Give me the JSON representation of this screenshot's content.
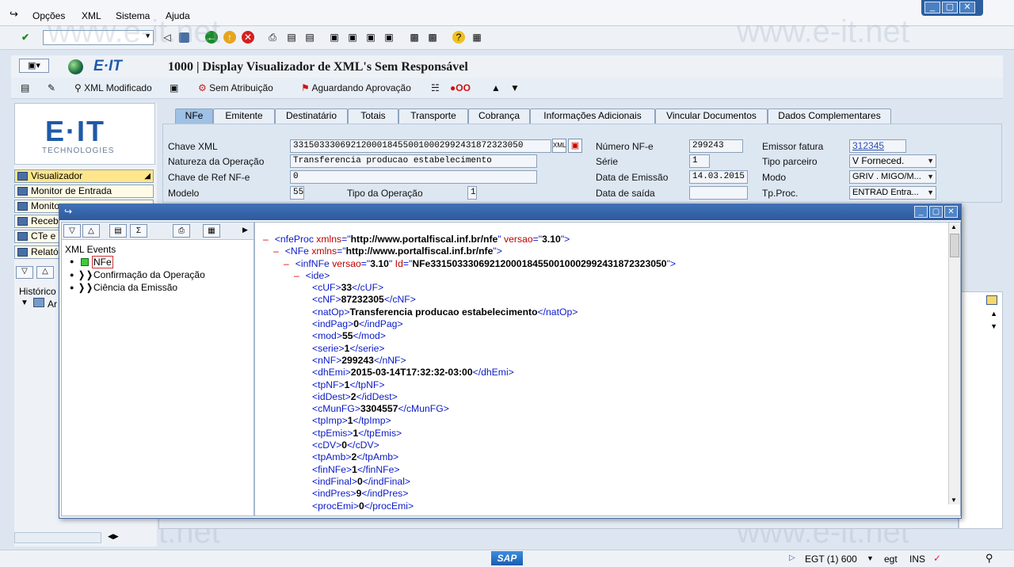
{
  "menu": {
    "items": [
      "Opções",
      "XML",
      "Sistema",
      "Ajuda"
    ]
  },
  "window_controls": [
    "_",
    "▢",
    "✕"
  ],
  "title": {
    "logo_text": "E·IT",
    "text": "1000 | Display Visualizador de XML's Sem Responsável"
  },
  "app_toolbar": {
    "xml_modificado": "XML Modificado",
    "sem_atribuicao": "Sem Atribuição",
    "aguardando": "Aguardando Aprovação"
  },
  "logo": {
    "brand": "E·IT",
    "sub": "TECHNOLOGIES"
  },
  "nav": {
    "visualizador": "Visualizador",
    "monitor_entrada": "Monitor de Entrada",
    "monitor2": "Monito",
    "receb": "Receb",
    "cte": "CTe e",
    "relat": "Relató",
    "historico": "Histórico",
    "ar": "Ar"
  },
  "tabs": [
    "NFe",
    "Emitente",
    "Destinatário",
    "Totais",
    "Transporte",
    "Cobrança",
    "Informações Adicionais",
    "Vincular Documentos",
    "Dados Complementares"
  ],
  "form": {
    "chave_xml_label": "Chave XML",
    "chave_xml_value": "33150333069212000184550010002992431872323050",
    "natureza_label": "Natureza da Operação",
    "natureza_value": "Transferencia producao estabelecimento",
    "chave_ref_label": "Chave de Ref NF-e",
    "chave_ref_value": "0",
    "modelo_label": "Modelo",
    "modelo_value": "55",
    "tipo_op_label": "Tipo da Operação",
    "tipo_op_value": "1",
    "numero_label": "Número NF-e",
    "numero_value": "299243",
    "serie_label": "Série",
    "serie_value": "1",
    "data_emissao_label": "Data de Emissão",
    "data_emissao_value": "14.03.2015",
    "data_saida_label": "Data de saída",
    "data_saida_value": "",
    "emissor_label": "Emissor fatura",
    "emissor_value": "312345",
    "tipo_parceiro_label": "Tipo parceiro",
    "tipo_parceiro_value": "V Forneced.",
    "modo_label": "Modo",
    "modo_value": "GRIV . MIGO/M...",
    "tpproc_label": "Tp.Proc.",
    "tpproc_value": "ENTRAD Entra..."
  },
  "tree": {
    "root": "XML Events",
    "nfe": "NFe",
    "confirmacao": "Confirmação da Operação",
    "ciencia": "Ciência da Emissão"
  },
  "xml_lines": [
    {
      "indent": 0,
      "minus": true,
      "open": "nfeProc",
      "attrs": [
        {
          "n": "xmlns",
          "v": "http://www.portalfiscal.inf.br/nfe"
        },
        {
          "n": "versao",
          "v": "3.10"
        }
      ]
    },
    {
      "indent": 1,
      "minus": true,
      "open": "NFe",
      "attrs": [
        {
          "n": "xmlns",
          "v": "http://www.portalfiscal.inf.br/nfe"
        }
      ]
    },
    {
      "indent": 2,
      "minus": true,
      "open": "infNFe",
      "attrs": [
        {
          "n": "versao",
          "v": "3.10"
        },
        {
          "n": "Id",
          "v": "NFe33150333069212000184550010002992431872323050"
        }
      ]
    },
    {
      "indent": 3,
      "minus": true,
      "open": "ide",
      "attrs": []
    },
    {
      "indent": 4,
      "tag": "cUF",
      "value": "33"
    },
    {
      "indent": 4,
      "tag": "cNF",
      "value": "87232305"
    },
    {
      "indent": 4,
      "tag": "natOp",
      "value": "Transferencia producao estabelecimento"
    },
    {
      "indent": 4,
      "tag": "indPag",
      "value": "0"
    },
    {
      "indent": 4,
      "tag": "mod",
      "value": "55"
    },
    {
      "indent": 4,
      "tag": "serie",
      "value": "1"
    },
    {
      "indent": 4,
      "tag": "nNF",
      "value": "299243"
    },
    {
      "indent": 4,
      "tag": "dhEmi",
      "value": "2015-03-14T17:32:32-03:00"
    },
    {
      "indent": 4,
      "tag": "tpNF",
      "value": "1"
    },
    {
      "indent": 4,
      "tag": "idDest",
      "value": "2"
    },
    {
      "indent": 4,
      "tag": "cMunFG",
      "value": "3304557"
    },
    {
      "indent": 4,
      "tag": "tpImp",
      "value": "1"
    },
    {
      "indent": 4,
      "tag": "tpEmis",
      "value": "1"
    },
    {
      "indent": 4,
      "tag": "cDV",
      "value": "0"
    },
    {
      "indent": 4,
      "tag": "tpAmb",
      "value": "2"
    },
    {
      "indent": 4,
      "tag": "finNFe",
      "value": "1"
    },
    {
      "indent": 4,
      "tag": "indFinal",
      "value": "0"
    },
    {
      "indent": 4,
      "tag": "indPres",
      "value": "9"
    },
    {
      "indent": 4,
      "tag": "procEmi",
      "value": "0"
    }
  ],
  "status": {
    "system": "EGT (1) 600",
    "client": "egt",
    "mode": "INS"
  },
  "watermark": "www.e-it.net"
}
